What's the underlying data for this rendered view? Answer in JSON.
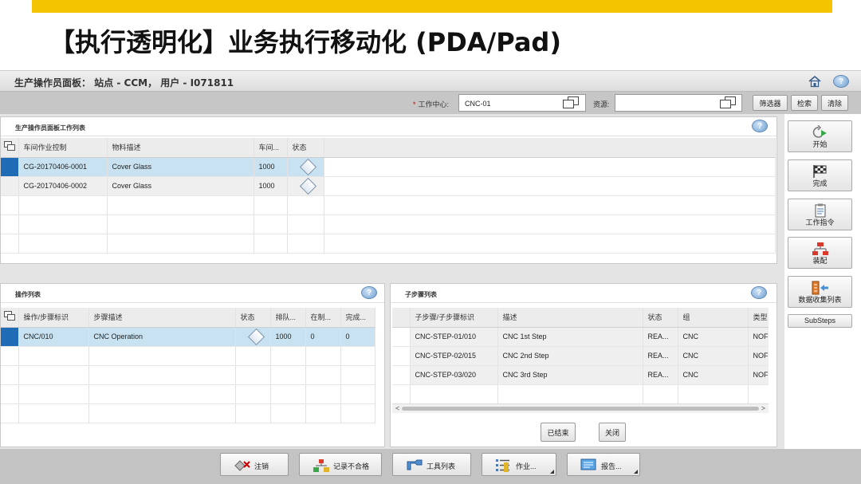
{
  "slide_title": "【执行透明化】业务执行移动化 (PDA/Pad)",
  "header": {
    "title": "生产操作员面板： 站点 - CCM， 用户 - I071811"
  },
  "filter": {
    "work_center_label": "工作中心:",
    "work_center_value": "CNC-01",
    "resource_label": "资源:",
    "resource_value": "",
    "filter_btn": "筛选器",
    "search_btn": "检索",
    "clear_btn": "清除"
  },
  "worklist": {
    "title": "生产操作员面板工作列表",
    "columns": [
      "车间作业控制",
      "物料描述",
      "车间...",
      "状态"
    ],
    "rows": [
      {
        "sfc": "CG-20170406-0001",
        "material": "Cover Glass",
        "qty": "1000"
      },
      {
        "sfc": "CG-20170406-0002",
        "material": "Cover Glass",
        "qty": "1000"
      }
    ]
  },
  "operations": {
    "title": "操作列表",
    "columns": [
      "操作/步骤标识",
      "步骤描述",
      "状态",
      "排队...",
      "在制...",
      "完成..."
    ],
    "rows": [
      {
        "op": "CNC/010",
        "desc": "CNC Operation",
        "queue": "1000",
        "wip": "0",
        "done": "0"
      }
    ]
  },
  "substeps": {
    "title": "子步骤列表",
    "columns": [
      "子步骤/子步骤标识",
      "描述",
      "状态",
      "组",
      "类型"
    ],
    "rows": [
      {
        "id": "CNC-STEP-01/010",
        "desc": "CNC 1st Step",
        "status": "REA...",
        "group": "CNC",
        "type": "NOF"
      },
      {
        "id": "CNC-STEP-02/015",
        "desc": "CNC 2nd Step",
        "status": "REA...",
        "group": "CNC",
        "type": "NOF"
      },
      {
        "id": "CNC-STEP-03/020",
        "desc": "CNC 3rd Step",
        "status": "REA...",
        "group": "CNC",
        "type": "NOF"
      }
    ],
    "finished_btn": "已结束",
    "close_btn": "关闭"
  },
  "side_buttons": {
    "start": "开始",
    "complete": "完成",
    "work_instruction": "工作指令",
    "assemble": "装配",
    "data_collection": "数据收集列表",
    "substeps": "SubSteps"
  },
  "bottom_buttons": {
    "signoff": "注销",
    "log_nc": "记录不合格",
    "tool_list": "工具列表",
    "work": "作业...",
    "report": "报告..."
  }
}
